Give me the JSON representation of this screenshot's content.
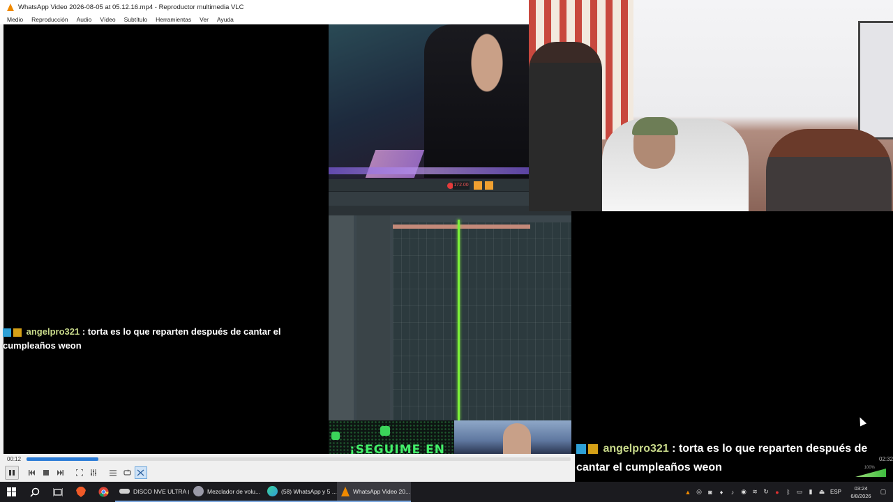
{
  "window": {
    "title": "WhatsApp Video 2026-08-05 at 05.12.16.mp4 - Reproductor multimedia VLC",
    "menu": [
      "Medio",
      "Reproducción",
      "Audio",
      "Vídeo",
      "Subtítulo",
      "Herramientas",
      "Ver",
      "Ayuda"
    ]
  },
  "fl_studio": {
    "tempo": "172.00"
  },
  "promo": {
    "text": "¡SEGUIME EN"
  },
  "chat_messages": [
    {
      "user": "angelpro321",
      "text": ": torta es lo que reparten después de cantar el cumpleaños weon"
    },
    {
      "user": "angelpro321",
      "text": ": torta es lo que reparten después de cantar el cumpleaños weon"
    }
  ],
  "player": {
    "elapsed": "00:12",
    "total": "02:32",
    "progress": 0.132,
    "volume_label": "100%",
    "controls": {
      "play_pause": "pause",
      "prev": "previous",
      "stop": "stop",
      "next": "next",
      "fullscreen": "fullscreen",
      "extended": "extended-settings",
      "playlist": "playlist",
      "loop": "loop",
      "shuffle": "shuffle"
    }
  },
  "taskbar": {
    "apps": [
      {
        "label": "DISCO NVE ULTRA (...",
        "icon": "game-controller-icon",
        "color": "#cfcfcf"
      },
      {
        "label": "Mezclador de volu...",
        "icon": "speaker-icon",
        "color": "#9a9aa8"
      },
      {
        "label": "(58) WhatsApp y 5 ...",
        "icon": "edge-icon",
        "color": "#2f9ed8"
      },
      {
        "label": "WhatsApp Video 20...",
        "icon": "vlc-icon",
        "color": "#f08a00"
      }
    ],
    "lang": "ESP",
    "time": "03:24",
    "date": "6/8/2026"
  }
}
